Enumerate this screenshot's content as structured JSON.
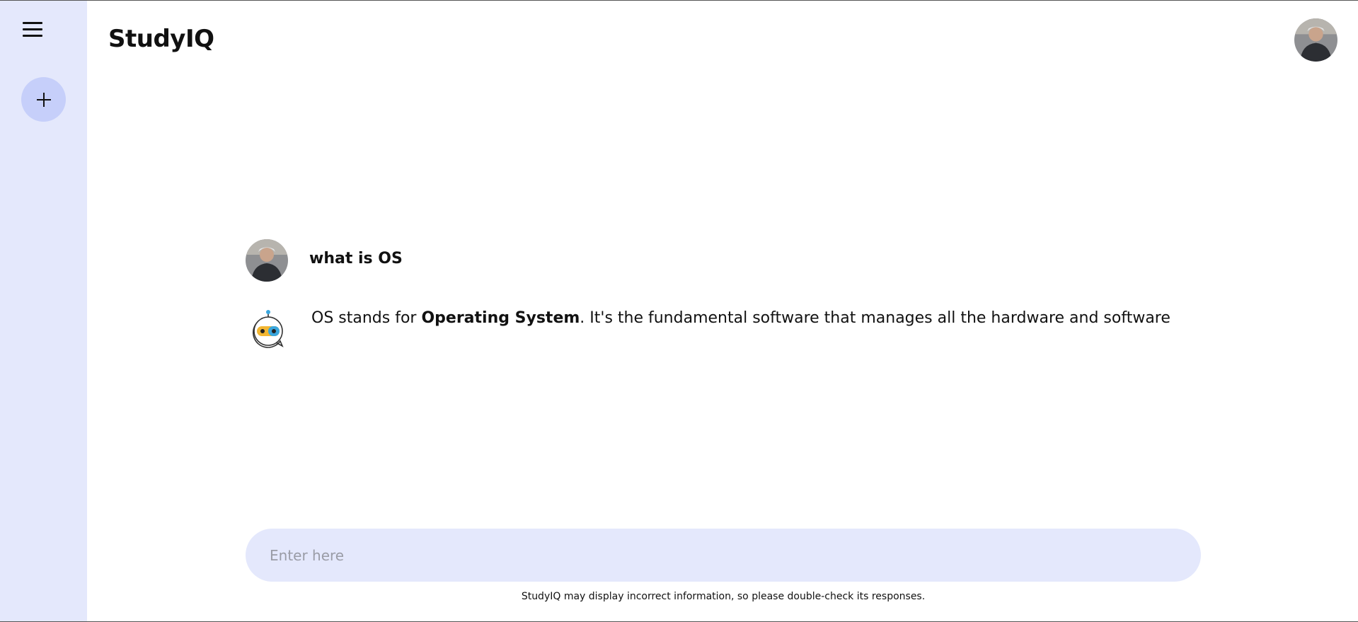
{
  "app": {
    "title": "StudyIQ"
  },
  "sidebar": {
    "menu_icon": "hamburger-menu-icon",
    "new_chat_icon": "plus-icon"
  },
  "conversation": {
    "user_message": "what is OS",
    "bot_message": {
      "prefix": "OS stands for ",
      "bold": "Operating System",
      "suffix": ". It's the fundamental software that manages all the hardware and software"
    }
  },
  "prompt": {
    "placeholder": "Enter here",
    "value": ""
  },
  "footer": {
    "disclaimer": "StudyIQ may display incorrect information, so please double-check its responses."
  },
  "colors": {
    "sidebar_bg": "#e4e8fc",
    "new_chat_bg": "#c6cffa",
    "input_bg": "#e4e8fc",
    "bot_accent_blue": "#3aa6dd",
    "bot_accent_yellow": "#f2b632"
  }
}
